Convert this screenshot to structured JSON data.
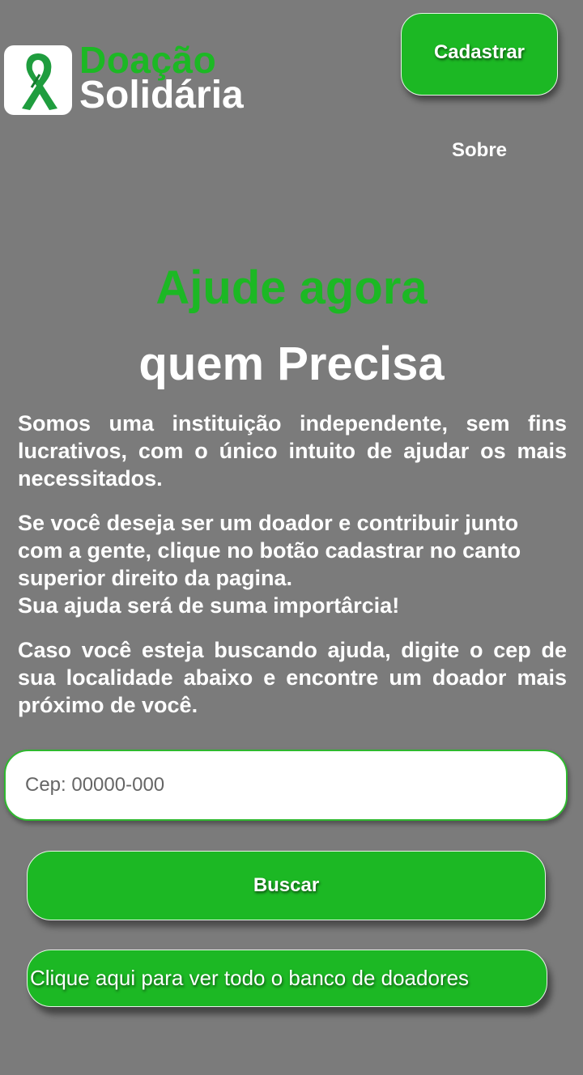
{
  "header": {
    "brand_line1": "Doação",
    "brand_line2": "Solidária",
    "logo_icon": "awareness-ribbon-icon",
    "cadastrar_label": "Cadastrar",
    "sobre_label": "Sobre"
  },
  "hero": {
    "headline_green": "Ajude agora",
    "headline_white": "quem Precisa"
  },
  "content": {
    "paragraph1": "Somos uma instituição independente, sem fins lucrativos, com o único intuito de ajudar os mais necessitados.",
    "paragraph2_line1": "Se você deseja ser um doador e contribuir junto com a gente, clique no botão cadastrar no canto superior direito da pagina.",
    "paragraph2_line2": "Sua ajuda será de suma importârcia!",
    "paragraph3": "Caso você esteja buscando ajuda, digite o cep de sua localidade abaixo e encontre um doador mais próximo de você."
  },
  "search": {
    "cep_placeholder": "Cep: 00000-000",
    "cep_value": "",
    "buscar_label": "Buscar",
    "banco_label": "Clique aqui para ver todo o banco de doadores"
  },
  "colors": {
    "background": "#7b7b7b",
    "accent_green": "#1cb824",
    "text_white": "#ffffff"
  }
}
